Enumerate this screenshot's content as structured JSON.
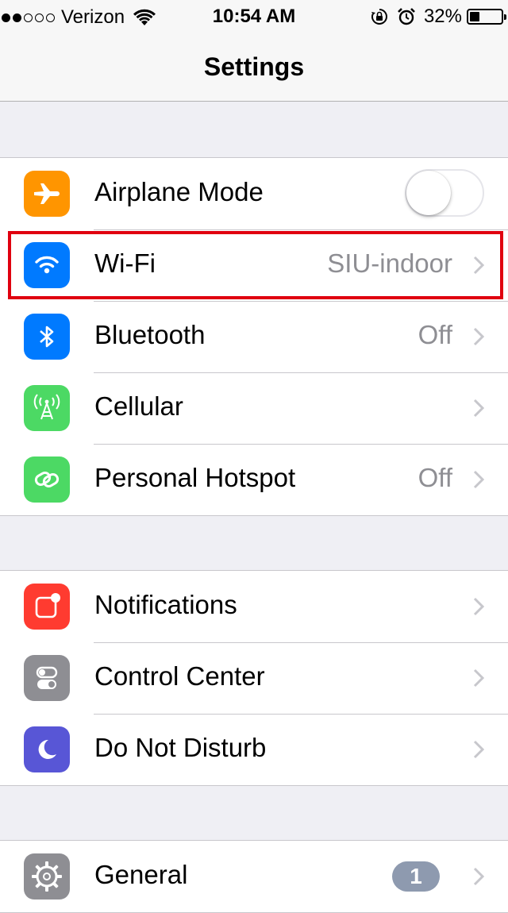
{
  "status_bar": {
    "signal_bars_filled": 2,
    "signal_bars_total": 5,
    "carrier": "Verizon",
    "wifi_icon": "wifi-icon",
    "time": "10:54 AM",
    "lock_icon": "orientation-lock-icon",
    "alarm_icon": "alarm-icon",
    "battery_percent": "32%",
    "battery_level": 0.32
  },
  "nav": {
    "title": "Settings"
  },
  "groups": [
    {
      "rows": [
        {
          "label": "Airplane Mode",
          "icon": "airplane-icon",
          "icon_color": "#ff9500",
          "accessory": "toggle",
          "toggle_on": false
        },
        {
          "label": "Wi-Fi",
          "icon": "wifi-icon",
          "icon_color": "#007aff",
          "value": "SIU-indoor",
          "accessory": "chevron",
          "highlighted": true,
          "highlight_color": "#e0000f"
        },
        {
          "label": "Bluetooth",
          "icon": "bluetooth-icon",
          "icon_color": "#007aff",
          "value": "Off",
          "accessory": "chevron"
        },
        {
          "label": "Cellular",
          "icon": "cellular-antenna-icon",
          "icon_color": "#4cd964",
          "accessory": "chevron"
        },
        {
          "label": "Personal Hotspot",
          "icon": "hotspot-link-icon",
          "icon_color": "#4cd964",
          "value": "Off",
          "accessory": "chevron"
        }
      ]
    },
    {
      "rows": [
        {
          "label": "Notifications",
          "icon": "notifications-icon",
          "icon_color": "#ff3b30",
          "accessory": "chevron"
        },
        {
          "label": "Control Center",
          "icon": "control-center-icon",
          "icon_color": "#8e8e93",
          "accessory": "chevron"
        },
        {
          "label": "Do Not Disturb",
          "icon": "moon-icon",
          "icon_color": "#5856d6",
          "accessory": "chevron"
        }
      ]
    },
    {
      "rows": [
        {
          "label": "General",
          "icon": "gear-icon",
          "icon_color": "#8e8e93",
          "badge": "1",
          "accessory": "chevron"
        }
      ]
    }
  ]
}
